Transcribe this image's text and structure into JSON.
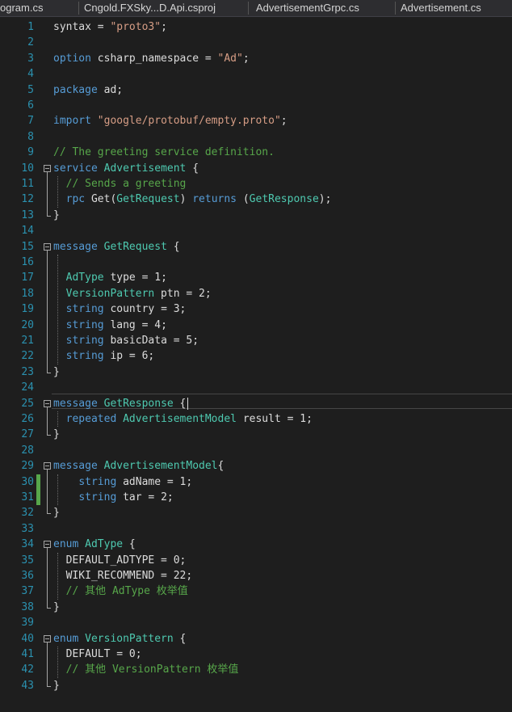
{
  "tabs": [
    "ogram.cs",
    "Cngold.FXSky...D.Api.csproj",
    "AdvertisementGrpc.cs",
    "Advertisement.cs"
  ],
  "lines": [
    {
      "n": "1",
      "parts": [
        {
          "t": "syntax = ",
          "c": ""
        },
        {
          "t": "\"proto3\"",
          "c": "str"
        },
        {
          "t": ";",
          "c": ""
        }
      ]
    },
    {
      "n": "2",
      "parts": []
    },
    {
      "n": "3",
      "parts": [
        {
          "t": "option",
          "c": "kw"
        },
        {
          "t": " csharp_namespace = ",
          "c": ""
        },
        {
          "t": "\"Ad\"",
          "c": "str"
        },
        {
          "t": ";",
          "c": ""
        }
      ]
    },
    {
      "n": "4",
      "parts": []
    },
    {
      "n": "5",
      "parts": [
        {
          "t": "package",
          "c": "kw"
        },
        {
          "t": " ad;",
          "c": ""
        }
      ]
    },
    {
      "n": "6",
      "parts": []
    },
    {
      "n": "7",
      "parts": [
        {
          "t": "import",
          "c": "kw"
        },
        {
          "t": " ",
          "c": ""
        },
        {
          "t": "\"google/protobuf/empty.proto\"",
          "c": "str"
        },
        {
          "t": ";",
          "c": ""
        }
      ]
    },
    {
      "n": "8",
      "parts": []
    },
    {
      "n": "9",
      "parts": [
        {
          "t": "// The greeting service definition.",
          "c": "cm"
        }
      ]
    },
    {
      "n": "10",
      "parts": [
        {
          "t": "service",
          "c": "kw"
        },
        {
          "t": " ",
          "c": ""
        },
        {
          "t": "Advertisement",
          "c": "ty"
        },
        {
          "t": " {",
          "c": ""
        }
      ]
    },
    {
      "n": "11",
      "parts": [
        {
          "t": "  ",
          "c": ""
        },
        {
          "t": "// Sends a greeting",
          "c": "cm"
        }
      ]
    },
    {
      "n": "12",
      "parts": [
        {
          "t": "  ",
          "c": ""
        },
        {
          "t": "rpc",
          "c": "kw"
        },
        {
          "t": " Get(",
          "c": ""
        },
        {
          "t": "GetRequest",
          "c": "ty"
        },
        {
          "t": ") ",
          "c": ""
        },
        {
          "t": "returns",
          "c": "kw"
        },
        {
          "t": " (",
          "c": ""
        },
        {
          "t": "GetResponse",
          "c": "ty"
        },
        {
          "t": ");",
          "c": ""
        }
      ]
    },
    {
      "n": "13",
      "parts": [
        {
          "t": "}",
          "c": ""
        }
      ]
    },
    {
      "n": "14",
      "parts": []
    },
    {
      "n": "15",
      "parts": [
        {
          "t": "message",
          "c": "kw"
        },
        {
          "t": " ",
          "c": ""
        },
        {
          "t": "GetRequest",
          "c": "ty"
        },
        {
          "t": " {",
          "c": ""
        }
      ]
    },
    {
      "n": "16",
      "parts": []
    },
    {
      "n": "17",
      "parts": [
        {
          "t": "  ",
          "c": ""
        },
        {
          "t": "AdType",
          "c": "ty"
        },
        {
          "t": " type = 1;",
          "c": ""
        }
      ]
    },
    {
      "n": "18",
      "parts": [
        {
          "t": "  ",
          "c": ""
        },
        {
          "t": "VersionPattern",
          "c": "ty"
        },
        {
          "t": " ptn = 2;",
          "c": ""
        }
      ]
    },
    {
      "n": "19",
      "parts": [
        {
          "t": "  ",
          "c": ""
        },
        {
          "t": "string",
          "c": "kw"
        },
        {
          "t": " country = 3;",
          "c": ""
        }
      ]
    },
    {
      "n": "20",
      "parts": [
        {
          "t": "  ",
          "c": ""
        },
        {
          "t": "string",
          "c": "kw"
        },
        {
          "t": " lang = 4;",
          "c": ""
        }
      ]
    },
    {
      "n": "21",
      "parts": [
        {
          "t": "  ",
          "c": ""
        },
        {
          "t": "string",
          "c": "kw"
        },
        {
          "t": " basicData = 5;",
          "c": ""
        }
      ]
    },
    {
      "n": "22",
      "parts": [
        {
          "t": "  ",
          "c": ""
        },
        {
          "t": "string",
          "c": "kw"
        },
        {
          "t": " ip = 6;",
          "c": ""
        }
      ]
    },
    {
      "n": "23",
      "parts": [
        {
          "t": "}",
          "c": ""
        }
      ]
    },
    {
      "n": "24",
      "parts": []
    },
    {
      "n": "25",
      "parts": [
        {
          "t": "message",
          "c": "kw"
        },
        {
          "t": " ",
          "c": ""
        },
        {
          "t": "GetResponse",
          "c": "ty"
        },
        {
          "t": " {",
          "c": ""
        }
      ]
    },
    {
      "n": "26",
      "parts": [
        {
          "t": "  ",
          "c": ""
        },
        {
          "t": "repeated",
          "c": "kw"
        },
        {
          "t": " ",
          "c": ""
        },
        {
          "t": "AdvertisementModel",
          "c": "ty"
        },
        {
          "t": " result = 1;",
          "c": ""
        }
      ]
    },
    {
      "n": "27",
      "parts": [
        {
          "t": "}",
          "c": ""
        }
      ]
    },
    {
      "n": "28",
      "parts": []
    },
    {
      "n": "29",
      "parts": [
        {
          "t": "message",
          "c": "kw"
        },
        {
          "t": " ",
          "c": ""
        },
        {
          "t": "AdvertisementModel",
          "c": "ty"
        },
        {
          "t": "{",
          "c": ""
        }
      ]
    },
    {
      "n": "30",
      "parts": [
        {
          "t": "    ",
          "c": ""
        },
        {
          "t": "string",
          "c": "kw"
        },
        {
          "t": " adName = 1;",
          "c": ""
        }
      ]
    },
    {
      "n": "31",
      "parts": [
        {
          "t": "    ",
          "c": ""
        },
        {
          "t": "string",
          "c": "kw"
        },
        {
          "t": " tar = 2;",
          "c": ""
        }
      ]
    },
    {
      "n": "32",
      "parts": [
        {
          "t": "}",
          "c": ""
        }
      ]
    },
    {
      "n": "33",
      "parts": []
    },
    {
      "n": "34",
      "parts": [
        {
          "t": "enum",
          "c": "kw"
        },
        {
          "t": " ",
          "c": ""
        },
        {
          "t": "AdType",
          "c": "ty"
        },
        {
          "t": " {",
          "c": ""
        }
      ]
    },
    {
      "n": "35",
      "parts": [
        {
          "t": "  DEFAULT_ADTYPE = 0;",
          "c": ""
        }
      ]
    },
    {
      "n": "36",
      "parts": [
        {
          "t": "  WIKI_RECOMMEND = 22;",
          "c": ""
        }
      ]
    },
    {
      "n": "37",
      "parts": [
        {
          "t": "  ",
          "c": ""
        },
        {
          "t": "// 其他 AdType 枚举值",
          "c": "cm"
        }
      ]
    },
    {
      "n": "38",
      "parts": [
        {
          "t": "}",
          "c": ""
        }
      ]
    },
    {
      "n": "39",
      "parts": []
    },
    {
      "n": "40",
      "parts": [
        {
          "t": "enum",
          "c": "kw"
        },
        {
          "t": " ",
          "c": ""
        },
        {
          "t": "VersionPattern",
          "c": "ty"
        },
        {
          "t": " {",
          "c": ""
        }
      ]
    },
    {
      "n": "41",
      "parts": [
        {
          "t": "  DEFAULT = 0;",
          "c": ""
        }
      ]
    },
    {
      "n": "42",
      "parts": [
        {
          "t": "  ",
          "c": ""
        },
        {
          "t": "// 其他 VersionPattern 枚举值",
          "c": "cm"
        }
      ]
    },
    {
      "n": "43",
      "parts": [
        {
          "t": "}",
          "c": ""
        }
      ]
    }
  ]
}
